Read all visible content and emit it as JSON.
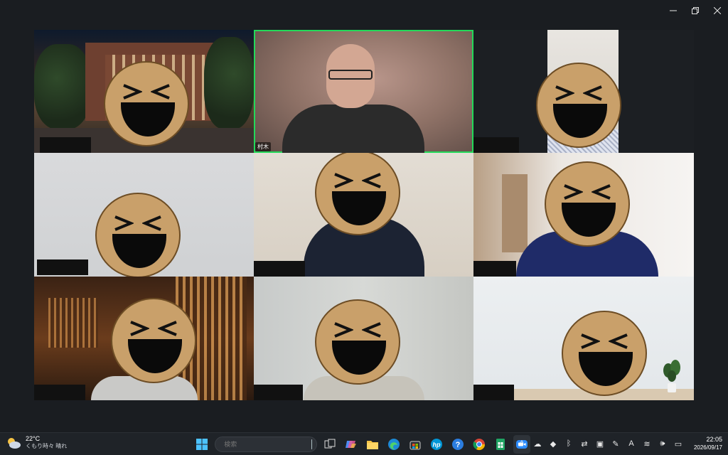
{
  "window": {
    "controls": [
      {
        "name": "minimize",
        "icon": "minimize-icon"
      },
      {
        "name": "restore",
        "icon": "restore-icon"
      },
      {
        "name": "close",
        "icon": "close-icon"
      }
    ]
  },
  "gallery": {
    "tiles": [
      {
        "scene": "station",
        "label": "",
        "active": false
      },
      {
        "scene": "room",
        "label": "村木",
        "active": true
      },
      {
        "scene": "dark",
        "label": "",
        "active": false
      },
      {
        "scene": "grey",
        "label": "",
        "active": false
      },
      {
        "scene": "warm",
        "label": "",
        "active": false
      },
      {
        "scene": "hall",
        "label": "",
        "active": false
      },
      {
        "scene": "wood",
        "label": "",
        "active": false
      },
      {
        "scene": "blur",
        "label": "",
        "active": false
      },
      {
        "scene": "white",
        "label": "",
        "active": false
      }
    ],
    "active_color": "#23d959",
    "face_color": "#c9a06a"
  },
  "taskbar": {
    "weather": {
      "temp": "22°C",
      "condition": "くもり時々 晴れ",
      "icon": "partly-cloudy-icon"
    },
    "search": {
      "placeholder": "検索"
    },
    "apps": [
      {
        "name": "start",
        "icon": "windows-start-icon"
      },
      {
        "name": "task-view",
        "icon": "task-view-icon"
      },
      {
        "name": "copilot",
        "icon": "copilot-icon"
      },
      {
        "name": "file-explorer",
        "icon": "folder-icon"
      },
      {
        "name": "edge",
        "icon": "edge-icon"
      },
      {
        "name": "store",
        "icon": "store-icon"
      },
      {
        "name": "hp",
        "icon": "hp-icon"
      },
      {
        "name": "help",
        "icon": "help-icon"
      },
      {
        "name": "chrome",
        "icon": "chrome-icon"
      },
      {
        "name": "sheets",
        "icon": "sheets-icon"
      },
      {
        "name": "zoom",
        "icon": "zoom-icon"
      }
    ],
    "tray": [
      {
        "icon": "chevron-up-icon"
      },
      {
        "icon": "onedrive-icon"
      },
      {
        "icon": "dropbox-icon"
      },
      {
        "icon": "bluetooth-icon"
      },
      {
        "icon": "share-icon"
      },
      {
        "icon": "screen-icon"
      },
      {
        "icon": "pen-icon"
      },
      {
        "icon": "font-a-icon"
      },
      {
        "icon": "wifi-icon"
      },
      {
        "icon": "volume-icon"
      },
      {
        "icon": "battery-icon"
      }
    ],
    "tray_glyphs": [
      "^",
      "☁",
      "◆",
      "ᛒ",
      "⇄",
      "▣",
      "✎",
      "A",
      "≋",
      "🕪",
      "▭"
    ],
    "clock": {
      "time": "22:05",
      "date": "2026/09/17"
    }
  }
}
